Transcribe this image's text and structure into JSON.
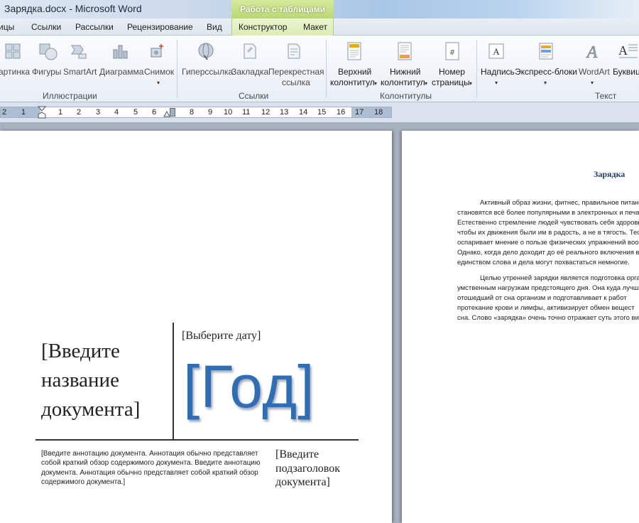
{
  "window": {
    "title": "Зарядка.docx - Microsoft Word",
    "contextual_group": "Работа с таблицами"
  },
  "tabs": {
    "partial_left": "ицы",
    "links": "Ссылки",
    "mailings": "Рассылки",
    "review": "Рецензирование",
    "view": "Вид",
    "design": "Конструктор",
    "layout": "Макет"
  },
  "ribbon": {
    "illustrations": {
      "label": "Иллюстрации",
      "picture": "артинка",
      "shapes": "Фигуры",
      "smartart": "SmartArt",
      "chart": "Диаграмма",
      "screenshot": "Снимок"
    },
    "links": {
      "label": "Ссылки",
      "hyperlink": "Гиперссылка",
      "bookmark": "Закладка",
      "crossref_line1": "Перекрестная",
      "crossref_line2": "ссылка"
    },
    "header_footer": {
      "label": "Колонтитулы",
      "header_line1": "Верхний",
      "header_line2": "колонтитул",
      "footer_line1": "Нижний",
      "footer_line2": "колонтитул",
      "page_number_line1": "Номер",
      "page_number_line2": "страницы"
    },
    "text": {
      "label": "Текст",
      "textbox": "Надпись",
      "quickparts": "Экспресс-блоки",
      "wordart": "WordArt",
      "dropcap": "Буквиц"
    }
  },
  "ruler": {
    "numbers_left": [
      "2",
      "1"
    ],
    "numbers_right": [
      "1",
      "2",
      "3",
      "4",
      "5",
      "6",
      "8",
      "9",
      "10",
      "11",
      "12",
      "13",
      "14",
      "15",
      "16",
      "17",
      "18"
    ]
  },
  "page1": {
    "doc_title_placeholder": "[Введите название документа]",
    "date_placeholder": "[Выберите дату]",
    "year_placeholder": "[Год]",
    "abstract_placeholder": "[Введите аннотацию документа. Аннотация обычно представляет собой краткий обзор содержимого документа. Введите аннотацию документа. Аннотация обычно представляет собой краткий обзор содержимого документа.]",
    "subtitle_placeholder": "[Введите подзаголовок документа]"
  },
  "page2": {
    "heading": "Зарядка",
    "paragraph1": [
      "Активный образ жизни, фитнес, правильное питан",
      "становятся всё более популярными в электронных и печат",
      "Естественно стремление людей чувствовать себя здоровы",
      "чтобы их движения были им в радость, а не в тягость. Тео",
      "оспаривает мнение о пользе физических упражнений воо",
      "Однако, когда дело доходит до её реального включения в",
      "единством слова и дела могут похвастаться немногие."
    ],
    "paragraph2": [
      "Целью утренней зарядки является подготовка орга",
      "умственным нагрузкам предстоящего дня. Она куда лучш",
      "отошедший от сна организм и подготавливает к работ",
      "протекание крови и лимфы, активизирует обмен вещест",
      "сна. Слово «зарядка» очень точно отражает суть этого вид"
    ]
  },
  "colors": {
    "year_blue": "#2f6db5",
    "workspace": "#a7b2bf",
    "contextual_green": "#b8d776"
  }
}
